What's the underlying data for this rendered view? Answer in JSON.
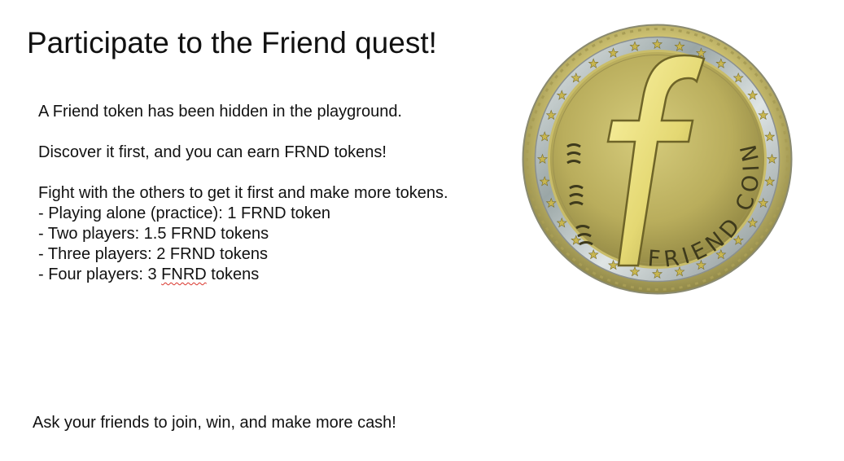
{
  "slide": {
    "title": "Participate to the Friend quest!",
    "intro": "A Friend token has been hidden in the playground.",
    "discover": "Discover it first, and you can earn FRND tokens!",
    "fight": "Fight with the others to get it first and make more tokens.",
    "rewards": {
      "alone": "- Playing alone (practice): 1 FRND token",
      "two": "- Two players: 1.5 FRND tokens",
      "three": "- Three players: 2 FRND tokens",
      "four_prefix": "- Four players: 3 ",
      "four_misspelled": "FNRD",
      "four_suffix": " tokens"
    },
    "footer": "Ask your friends to join, win, and make more cash!"
  },
  "coin": {
    "letter": "f",
    "ring_text": "FRIEND COIN",
    "side_text": "EEE",
    "colors": {
      "gold": "#c9b85a",
      "gold_light": "#f0e58a",
      "silver": "#b9c0c0",
      "edge": "#8a8a70"
    }
  }
}
